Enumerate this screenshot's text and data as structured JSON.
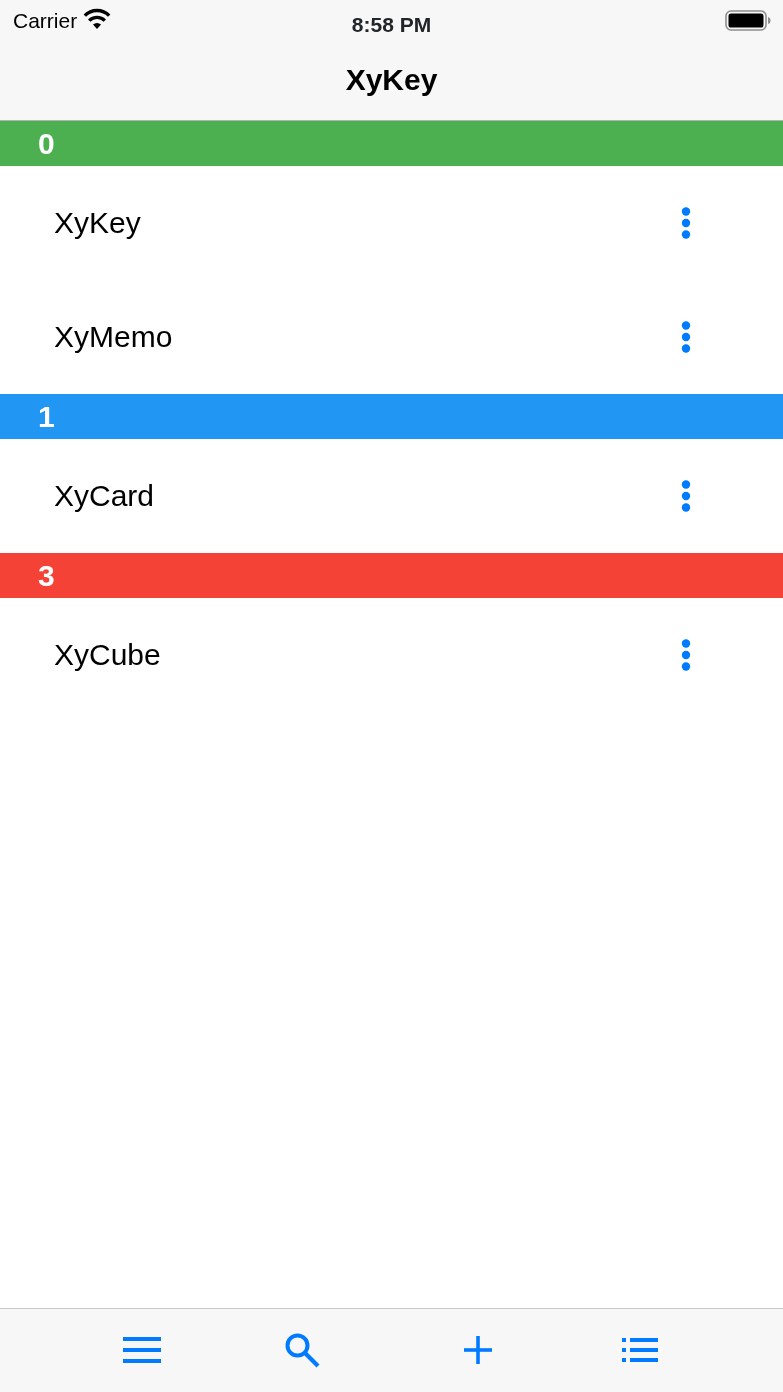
{
  "status_bar": {
    "carrier": "Carrier",
    "time": "8:58 PM"
  },
  "navigation_bar": {
    "title": "XyKey"
  },
  "sections": [
    {
      "label": "0",
      "color": "#4caf50",
      "items": [
        {
          "label": "XyKey"
        },
        {
          "label": "XyMemo"
        }
      ]
    },
    {
      "label": "1",
      "color": "#2196f3",
      "items": [
        {
          "label": "XyCard"
        }
      ]
    },
    {
      "label": "3",
      "color": "#f44336",
      "items": [
        {
          "label": "XyCube"
        }
      ]
    }
  ]
}
